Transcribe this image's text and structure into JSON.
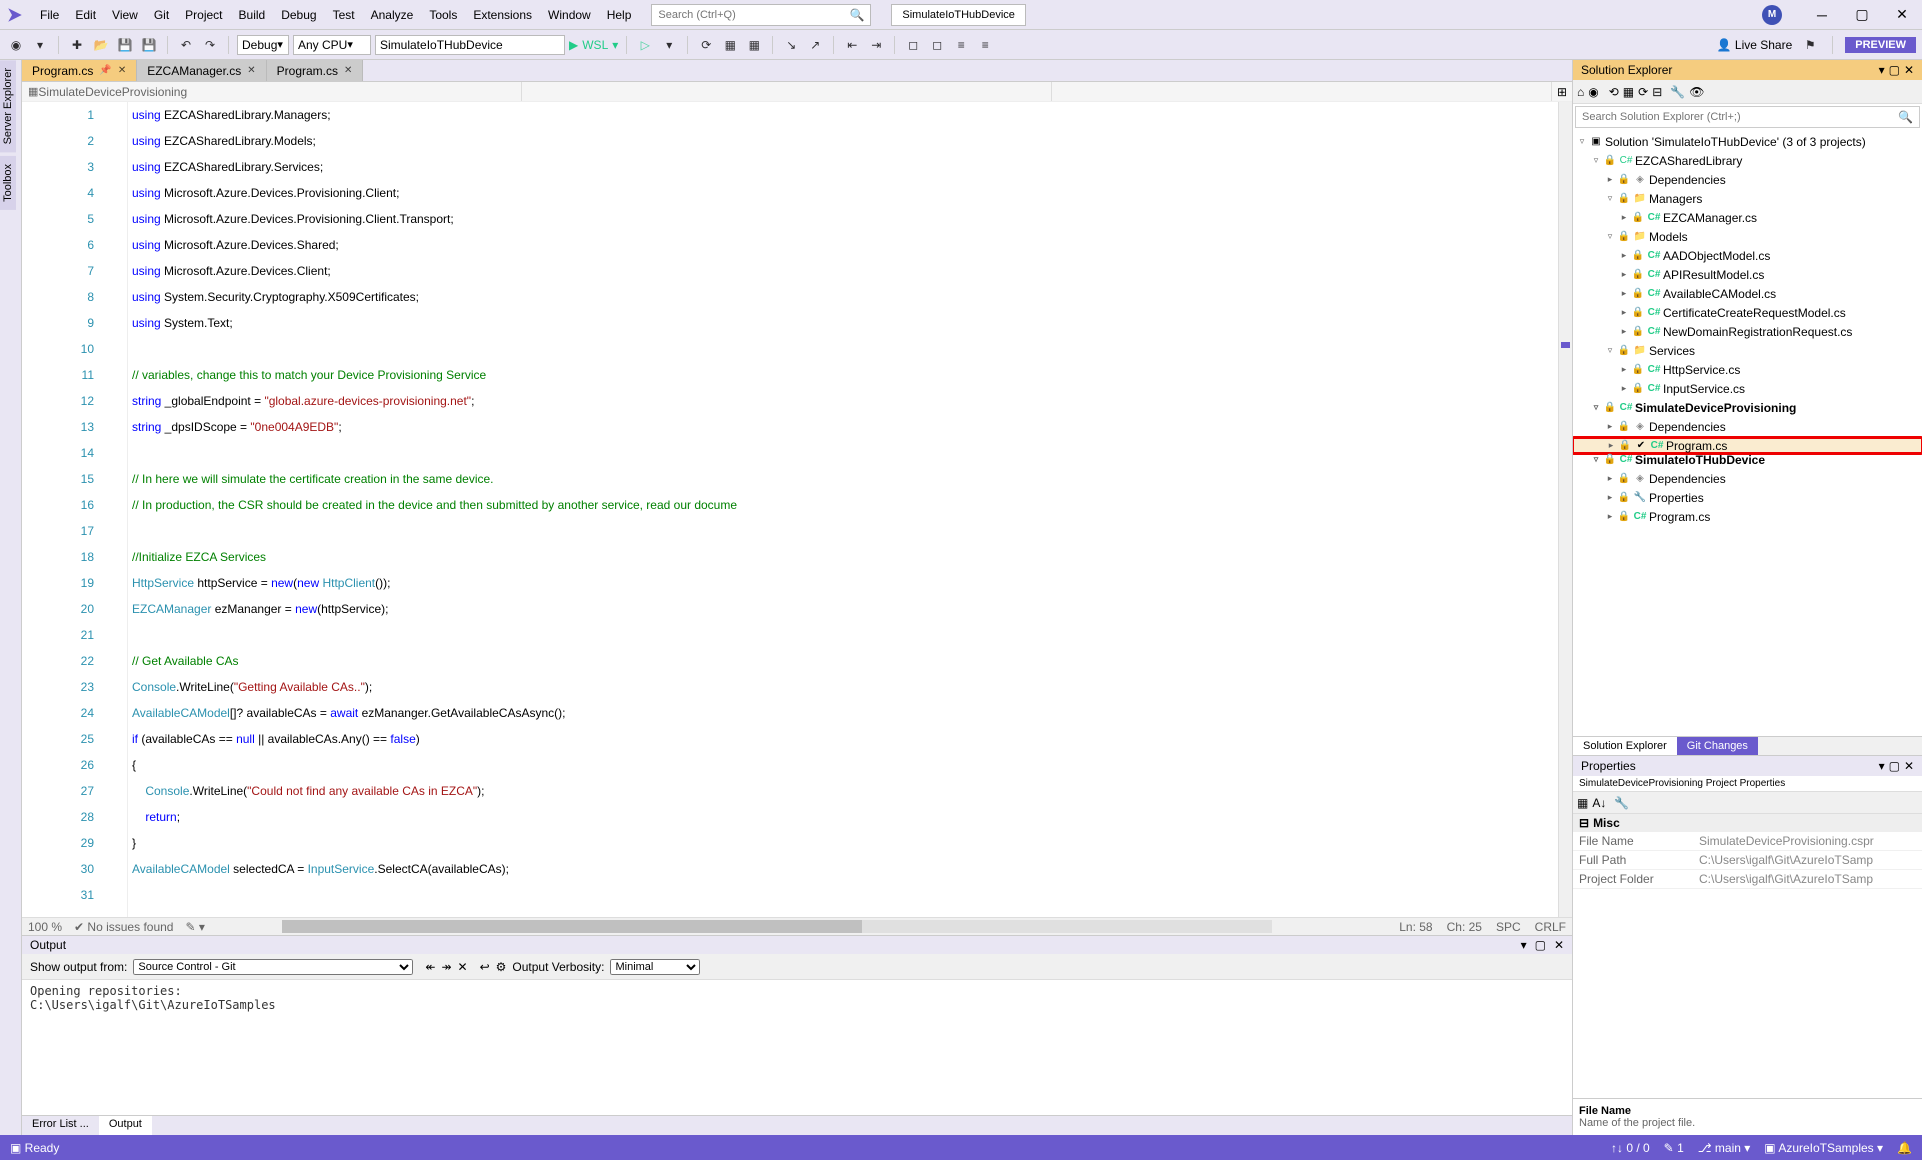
{
  "titlebar": {
    "menus": [
      "File",
      "Edit",
      "View",
      "Git",
      "Project",
      "Build",
      "Debug",
      "Test",
      "Analyze",
      "Tools",
      "Extensions",
      "Window",
      "Help"
    ],
    "search_placeholder": "Search (Ctrl+Q)",
    "solution": "SimulateIoTHubDevice",
    "avatar": "M"
  },
  "toolbar": {
    "config": "Debug",
    "platform": "Any CPU",
    "startup": "SimulateIoTHubDevice",
    "run": "WSL",
    "live_share": "Live Share",
    "preview": "PREVIEW"
  },
  "tabs": [
    {
      "label": "Program.cs",
      "active": true,
      "pinned": true
    },
    {
      "label": "EZCAManager.cs",
      "active": false
    },
    {
      "label": "Program.cs",
      "active": false
    }
  ],
  "nav": {
    "left": "SimulateDeviceProvisioning",
    "mid": "",
    "right": ""
  },
  "code": {
    "lines": [
      {
        "n": 1,
        "html": "<span class='kw'>using</span> EZCASharedLibrary.Managers;"
      },
      {
        "n": 2,
        "html": "<span class='kw'>using</span> EZCASharedLibrary.Models;"
      },
      {
        "n": 3,
        "html": "<span class='kw'>using</span> EZCASharedLibrary.Services;"
      },
      {
        "n": 4,
        "html": "<span class='kw'>using</span> Microsoft.Azure.Devices.Provisioning.Client;"
      },
      {
        "n": 5,
        "html": "<span class='kw'>using</span> Microsoft.Azure.Devices.Provisioning.Client.Transport;"
      },
      {
        "n": 6,
        "html": "<span class='kw'>using</span> Microsoft.Azure.Devices.Shared;"
      },
      {
        "n": 7,
        "html": "<span class='kw'>using</span> Microsoft.Azure.Devices.Client;"
      },
      {
        "n": 8,
        "html": "<span class='kw'>using</span> System.Security.Cryptography.X509Certificates;"
      },
      {
        "n": 9,
        "html": "<span class='kw'>using</span> System.Text;"
      },
      {
        "n": 10,
        "html": ""
      },
      {
        "n": 11,
        "html": "<span class='cmt'>// variables, change this to match your Device Provisioning Service</span>"
      },
      {
        "n": 12,
        "html": "<span class='kw'>string</span> _globalEndpoint = <span class='str'>\"global.azure-devices-provisioning.net\"</span>;"
      },
      {
        "n": 13,
        "html": "<span class='kw'>string</span> _dpsIDScope = <span class='str'>\"0ne004A9EDB\"</span>;"
      },
      {
        "n": 14,
        "html": ""
      },
      {
        "n": 15,
        "html": "<span class='cmt'>// In here we will simulate the certificate creation in the same device.</span>"
      },
      {
        "n": 16,
        "html": "<span class='cmt'>// In production, the CSR should be created in the device and then submitted by another service, read our docume</span>"
      },
      {
        "n": 17,
        "html": ""
      },
      {
        "n": 18,
        "html": "<span class='cmt'>//Initialize EZCA Services</span>"
      },
      {
        "n": 19,
        "html": "<span class='type'>HttpService</span> httpService = <span class='kw'>new</span>(<span class='kw'>new</span> <span class='type'>HttpClient</span>());"
      },
      {
        "n": 20,
        "html": "<span class='type'>EZCAManager</span> ezMananger = <span class='kw'>new</span>(httpService);"
      },
      {
        "n": 21,
        "html": ""
      },
      {
        "n": 22,
        "html": "<span class='cmt'>// Get Available CAs</span>"
      },
      {
        "n": 23,
        "html": "<span class='type'>Console</span>.WriteLine(<span class='str'>\"Getting Available CAs..\"</span>);"
      },
      {
        "n": 24,
        "html": "<span class='type'>AvailableCAModel</span>[]? availableCAs = <span class='kw'>await</span> ezMananger.GetAvailableCAsAsync();"
      },
      {
        "n": 25,
        "html": "<span class='kw'>if</span> (availableCAs == <span class='kw'>null</span> || availableCAs.Any() == <span class='kw'>false</span>)"
      },
      {
        "n": 26,
        "html": "{"
      },
      {
        "n": 27,
        "html": "    <span class='type'>Console</span>.WriteLine(<span class='str'>\"Could not find any available CAs in EZCA\"</span>);"
      },
      {
        "n": 28,
        "html": "    <span class='kw'>return</span>;"
      },
      {
        "n": 29,
        "html": "}"
      },
      {
        "n": 30,
        "html": "<span class='type'>AvailableCAModel</span> selectedCA = <span class='type'>InputService</span>.SelectCA(availableCAs);"
      },
      {
        "n": 31,
        "html": ""
      }
    ]
  },
  "editor_status": {
    "zoom": "100 %",
    "issues": "No issues found",
    "ln": "Ln: 58",
    "ch": "Ch: 25",
    "spc": "SPC",
    "crlf": "CRLF"
  },
  "output": {
    "title": "Output",
    "show_from": "Show output from:",
    "source": "Source Control - Git",
    "verbosity_label": "Output Verbosity:",
    "verbosity": "Minimal",
    "text": "Opening repositories:\nC:\\Users\\igalf\\Git\\AzureIoTSamples"
  },
  "bottom_tabs": {
    "error": "Error List ...",
    "output": "Output"
  },
  "solution_explorer": {
    "title": "Solution Explorer",
    "search_placeholder": "Search Solution Explorer (Ctrl+;)",
    "root": "Solution 'SimulateIoTHubDevice' (3 of 3 projects)",
    "tree": [
      {
        "indent": 1,
        "ico": "proj",
        "label": "EZCASharedLibrary",
        "exp": "▿"
      },
      {
        "indent": 2,
        "ico": "deps",
        "label": "Dependencies",
        "exp": "▸"
      },
      {
        "indent": 2,
        "ico": "folder",
        "label": "Managers",
        "exp": "▿"
      },
      {
        "indent": 3,
        "ico": "cs",
        "label": "EZCAManager.cs",
        "exp": "▸"
      },
      {
        "indent": 2,
        "ico": "folder",
        "label": "Models",
        "exp": "▿"
      },
      {
        "indent": 3,
        "ico": "cs",
        "label": "AADObjectModel.cs",
        "exp": "▸"
      },
      {
        "indent": 3,
        "ico": "cs",
        "label": "APIResultModel.cs",
        "exp": "▸"
      },
      {
        "indent": 3,
        "ico": "cs",
        "label": "AvailableCAModel.cs",
        "exp": "▸"
      },
      {
        "indent": 3,
        "ico": "cs",
        "label": "CertificateCreateRequestModel.cs",
        "exp": "▸"
      },
      {
        "indent": 3,
        "ico": "cs",
        "label": "NewDomainRegistrationRequest.cs",
        "exp": "▸"
      },
      {
        "indent": 2,
        "ico": "folder",
        "label": "Services",
        "exp": "▿"
      },
      {
        "indent": 3,
        "ico": "cs",
        "label": "HttpService.cs",
        "exp": "▸"
      },
      {
        "indent": 3,
        "ico": "cs",
        "label": "InputService.cs",
        "exp": "▸"
      },
      {
        "indent": 1,
        "ico": "proj",
        "label": "SimulateDeviceProvisioning",
        "exp": "▿",
        "bold": true
      },
      {
        "indent": 2,
        "ico": "deps",
        "label": "Dependencies",
        "exp": "▸"
      },
      {
        "indent": 2,
        "ico": "cs",
        "label": "Program.cs",
        "exp": "▸",
        "redbox": true,
        "checked": true,
        "highlight": true
      },
      {
        "indent": 1,
        "ico": "proj",
        "label": "SimulateIoTHubDevice",
        "exp": "▿",
        "bold": true,
        "overlap": true
      },
      {
        "indent": 2,
        "ico": "deps",
        "label": "Dependencies",
        "exp": "▸"
      },
      {
        "indent": 2,
        "ico": "props",
        "label": "Properties",
        "exp": "▸"
      },
      {
        "indent": 2,
        "ico": "cs",
        "label": "Program.cs",
        "exp": "▸"
      }
    ],
    "bottom_tabs": {
      "se": "Solution Explorer",
      "git": "Git Changes"
    }
  },
  "properties": {
    "title": "Properties",
    "subject": "SimulateDeviceProvisioning Project Properties",
    "cat": "Misc",
    "rows": [
      {
        "k": "File Name",
        "v": "SimulateDeviceProvisioning.cspr"
      },
      {
        "k": "Full Path",
        "v": "C:\\Users\\igalf\\Git\\AzureIoTSamp"
      },
      {
        "k": "Project Folder",
        "v": "C:\\Users\\igalf\\Git\\AzureIoTSamp"
      }
    ],
    "desc_name": "File Name",
    "desc_text": "Name of the project file."
  },
  "statusbar": {
    "ready": "Ready",
    "updown": "↑↓ 0 / 0",
    "changes": "1",
    "branch": "main",
    "repo": "AzureIoTSamples"
  }
}
